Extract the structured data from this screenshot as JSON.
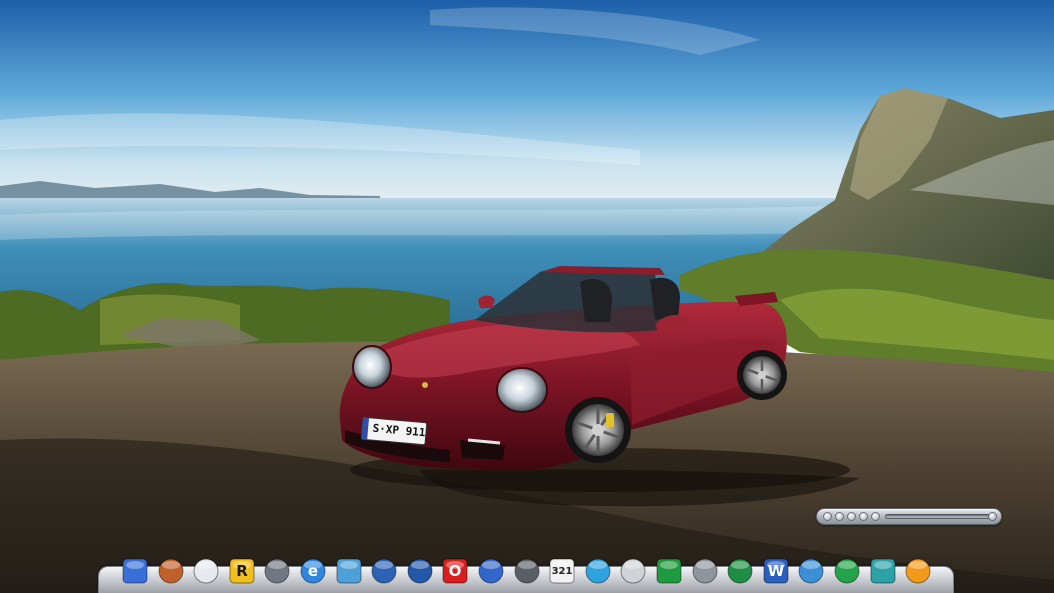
{
  "desktop": {
    "wallpaper": "red-convertible-sports-car-on-cliff",
    "license_plate": "S·XP 911"
  },
  "media_widget": {
    "buttons": [
      "previous-icon",
      "rewind-icon",
      "play-icon",
      "forward-icon",
      "next-icon"
    ]
  },
  "dock": {
    "items": [
      {
        "icon": "display-settings-icon",
        "label": "",
        "color": "#3b6fd8"
      },
      {
        "icon": "toolbox-icon",
        "label": "",
        "color": "#c0602a"
      },
      {
        "icon": "document-icon",
        "label": "",
        "color": "#e6e9ee"
      },
      {
        "icon": "rar-archive-icon",
        "label": "R",
        "color": "#f0c020"
      },
      {
        "icon": "calculator-icon",
        "label": "",
        "color": "#707780"
      },
      {
        "icon": "internet-explorer-icon",
        "label": "e",
        "color": "#2f86e0"
      },
      {
        "icon": "magnifier-globe-icon",
        "label": "",
        "color": "#4da0d8"
      },
      {
        "icon": "book-icon",
        "label": "",
        "color": "#2c63b5"
      },
      {
        "icon": "globe-icon",
        "label": "",
        "color": "#2357a8"
      },
      {
        "icon": "opera-icon",
        "label": "O",
        "color": "#d81e1e"
      },
      {
        "icon": "floppy-disk-icon",
        "label": "",
        "color": "#3266c8"
      },
      {
        "icon": "camera-icon",
        "label": "",
        "color": "#5a5f66"
      },
      {
        "icon": "calendar-icon",
        "label": "321",
        "color": "#f2f2f2"
      },
      {
        "icon": "media-player-icon",
        "label": "",
        "color": "#2fa3e0"
      },
      {
        "icon": "system-preferences-icon",
        "label": "",
        "color": "#d0d3d8"
      },
      {
        "icon": "network-globe-icon",
        "label": "",
        "color": "#1f9a3e"
      },
      {
        "icon": "utilities-icon",
        "label": "",
        "color": "#8f959c"
      },
      {
        "icon": "earth-icon",
        "label": "",
        "color": "#1e8e44"
      },
      {
        "icon": "word-icon",
        "label": "W",
        "color": "#2b5fbf"
      },
      {
        "icon": "safari-compass-icon",
        "label": "",
        "color": "#3a8fd6"
      },
      {
        "icon": "green-orb-icon",
        "label": "",
        "color": "#23a34a"
      },
      {
        "icon": "pen-tool-icon",
        "label": "",
        "color": "#2aa2a6"
      },
      {
        "icon": "flower-icon",
        "label": "",
        "color": "#f39a1b"
      }
    ]
  }
}
